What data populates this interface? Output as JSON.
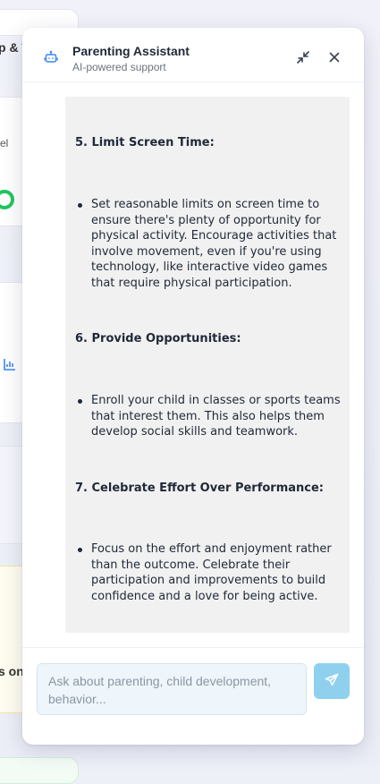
{
  "background": {
    "fragments": [
      "p & T",
      "el",
      "s on"
    ]
  },
  "assistant": {
    "title": "Parenting Assistant",
    "subtitle": "AI-powered support",
    "icons": {
      "bot": "bot-icon",
      "minimize": "minimize-icon",
      "close": "close-icon",
      "send": "send-icon"
    },
    "message": {
      "sections": [
        {
          "heading": "5. Limit Screen Time:",
          "bullets": [
            "Set reasonable limits on screen time to ensure there's plenty of opportunity for physical activity. Encourage activities that involve movement, even if you're using technology, like interactive video games that require physical participation."
          ]
        },
        {
          "heading": "6. Provide Opportunities:",
          "bullets": [
            "Enroll your child in classes or sports teams that interest them. This also helps them develop social skills and teamwork."
          ]
        },
        {
          "heading": "7. Celebrate Effort Over Performance:",
          "bullets": [
            "Focus on the effort and enjoyment rather than the outcome. Celebrate their participation and improvements to build confidence and a love for being active."
          ]
        }
      ]
    },
    "input": {
      "placeholder": "Ask about parenting, child development, behavior...",
      "value": ""
    }
  },
  "colors": {
    "accent": "#0ea5e9",
    "send_button": "#8fd0ef",
    "bubble": "#f1f1f2"
  }
}
